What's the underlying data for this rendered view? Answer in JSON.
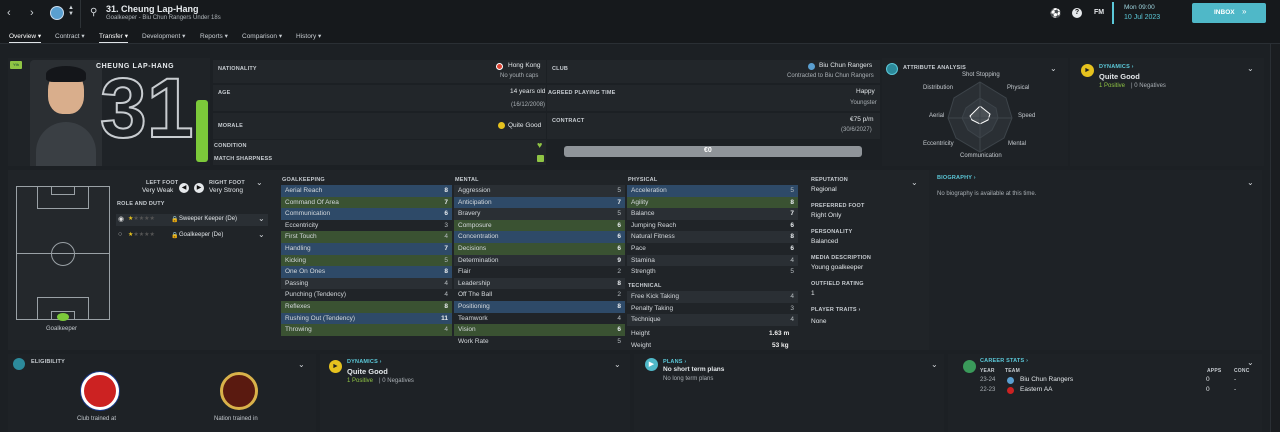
{
  "header": {
    "player_title": "31. Cheung Lap-Hang",
    "player_subtitle": "Goalkeeper - Biu Chun Rangers Under 18s",
    "day": "Mon 09:00",
    "date": "10 Jul 2023",
    "inbox_label": "INBOX",
    "fm_label": "FM"
  },
  "tabs": [
    {
      "label": "Overview"
    },
    {
      "label": "Contract"
    },
    {
      "label": "Transfer"
    },
    {
      "label": "Development"
    },
    {
      "label": "Reports"
    },
    {
      "label": "Comparison"
    },
    {
      "label": "History"
    }
  ],
  "profile": {
    "name": "CHEUNG LAP-HANG",
    "number": "31",
    "youth_badge": "Yth"
  },
  "info": {
    "nationality_label": "NATIONALITY",
    "nationality": "Hong Kong",
    "youth_caps": "No youth caps",
    "club_label": "CLUB",
    "club": "Biu Chun Rangers",
    "club_status": "Contracted to Biu Chun Rangers",
    "age_label": "AGE",
    "age": "14 years old",
    "dob": "(16/12/2008)",
    "agreed_label": "AGREED PLAYING TIME",
    "happiness": "Happy",
    "playing_time": "Youngster",
    "morale_label": "MORALE",
    "morale": "Quite Good",
    "contract_label": "CONTRACT",
    "wage": "€75 p/m",
    "contract_end": "(30/6/2027)",
    "condition_label": "CONDITION",
    "sharpness_label": "MATCH SHARPNESS",
    "value": "€0"
  },
  "attr_analysis": {
    "title": "ATTRIBUTE ANALYSIS",
    "labels": [
      "Shot Stopping",
      "Physical",
      "Speed",
      "Mental",
      "Communication",
      "Eccentricity",
      "Aerial",
      "Distribution"
    ]
  },
  "dynamics_top": {
    "title": "DYNAMICS",
    "rating": "Quite Good",
    "positive": "1 Positive",
    "negatives": "0 Negatives"
  },
  "position": {
    "left_foot_label": "LEFT FOOT",
    "left_foot": "Very Weak",
    "right_foot_label": "RIGHT FOOT",
    "right_foot": "Very Strong",
    "role_label": "ROLE AND DUTY",
    "role1": "Sweeper Keeper (De)",
    "role2": "Goalkeeper (De)",
    "pos_name": "Goalkeeper"
  },
  "goalkeeping": {
    "title": "GOALKEEPING",
    "rows": [
      {
        "n": "Aerial Reach",
        "v": "8"
      },
      {
        "n": "Command Of Area",
        "v": "7"
      },
      {
        "n": "Communication",
        "v": "6"
      },
      {
        "n": "Eccentricity",
        "v": "3"
      },
      {
        "n": "First Touch",
        "v": "4"
      },
      {
        "n": "Handling",
        "v": "7"
      },
      {
        "n": "Kicking",
        "v": "5"
      },
      {
        "n": "One On Ones",
        "v": "8"
      },
      {
        "n": "Passing",
        "v": "4"
      },
      {
        "n": "Punching (Tendency)",
        "v": "4"
      },
      {
        "n": "Reflexes",
        "v": "8"
      },
      {
        "n": "Rushing Out (Tendency)",
        "v": "11"
      },
      {
        "n": "Throwing",
        "v": "4"
      }
    ]
  },
  "mental": {
    "title": "MENTAL",
    "rows": [
      {
        "n": "Aggression",
        "v": "5"
      },
      {
        "n": "Anticipation",
        "v": "7"
      },
      {
        "n": "Bravery",
        "v": "5"
      },
      {
        "n": "Composure",
        "v": "6"
      },
      {
        "n": "Concentration",
        "v": "6"
      },
      {
        "n": "Decisions",
        "v": "6"
      },
      {
        "n": "Determination",
        "v": "9"
      },
      {
        "n": "Flair",
        "v": "2"
      },
      {
        "n": "Leadership",
        "v": "8"
      },
      {
        "n": "Off The Ball",
        "v": "2"
      },
      {
        "n": "Positioning",
        "v": "8"
      },
      {
        "n": "Teamwork",
        "v": "4"
      },
      {
        "n": "Vision",
        "v": "6"
      },
      {
        "n": "Work Rate",
        "v": "5"
      }
    ]
  },
  "physical": {
    "title": "PHYSICAL",
    "rows": [
      {
        "n": "Acceleration",
        "v": "5"
      },
      {
        "n": "Agility",
        "v": "8"
      },
      {
        "n": "Balance",
        "v": "7"
      },
      {
        "n": "Jumping Reach",
        "v": "6"
      },
      {
        "n": "Natural Fitness",
        "v": "8"
      },
      {
        "n": "Pace",
        "v": "6"
      },
      {
        "n": "Stamina",
        "v": "4"
      },
      {
        "n": "Strength",
        "v": "5"
      }
    ]
  },
  "technical": {
    "title": "TECHNICAL",
    "rows": [
      {
        "n": "Free Kick Taking",
        "v": "4"
      },
      {
        "n": "Penalty Taking",
        "v": "3"
      },
      {
        "n": "Technique",
        "v": "4"
      }
    ],
    "height_label": "Height",
    "height": "1.63 m",
    "weight_label": "Weight",
    "weight": "53 kg"
  },
  "details": {
    "reputation_label": "REPUTATION",
    "reputation": "Regional",
    "pref_foot_label": "PREFERRED FOOT",
    "pref_foot": "Right Only",
    "personality_label": "PERSONALITY",
    "personality": "Balanced",
    "media_label": "MEDIA DESCRIPTION",
    "media": "Young goalkeeper",
    "outfield_label": "OUTFIELD RATING",
    "outfield": "1",
    "traits_label": "PLAYER TRAITS",
    "traits": "None"
  },
  "bio": {
    "title": "BIOGRAPHY",
    "text": "No biography is available at this time."
  },
  "eligibility": {
    "title": "ELIGIBILITY",
    "club_trained": "Club trained at",
    "nation_trained": "Nation trained in"
  },
  "dynamics_bottom": {
    "title": "DYNAMICS",
    "rating": "Quite Good",
    "positive": "1 Positive",
    "negatives": "0 Negatives"
  },
  "plans": {
    "title": "PLANS",
    "short": "No short term plans",
    "long": "No long term plans"
  },
  "career": {
    "title": "CAREER STATS",
    "year_h": "YEAR",
    "team_h": "TEAM",
    "apps_h": "APPS",
    "conc_h": "CONC",
    "rows": [
      {
        "year": "23-24",
        "team": "Biu Chun Rangers",
        "apps": "0",
        "conc": "-"
      },
      {
        "year": "22-23",
        "team": "Eastern AA",
        "apps": "0",
        "conc": "-"
      }
    ]
  },
  "colors": {
    "accent": "#5bc8d8",
    "positive": "#8fc444",
    "highlight": "#2e4a68"
  }
}
